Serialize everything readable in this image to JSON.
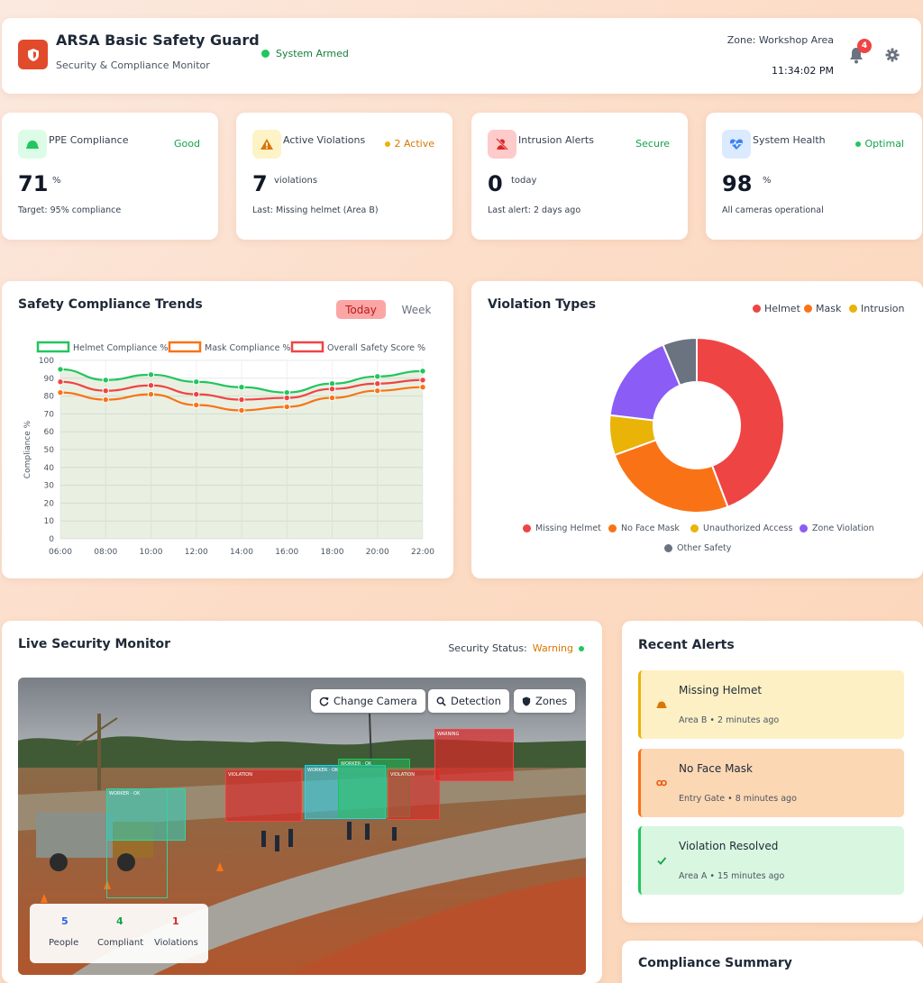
{
  "header": {
    "title": "ARSA Basic Safety Guard",
    "subtitle": "Security & Compliance Monitor",
    "system_status": "System Armed",
    "zone": "Zone: Workshop Area",
    "time": "11:34:02 PM",
    "notification_count": "4"
  },
  "stats": [
    {
      "label": "PPE Compliance",
      "badge": "Good",
      "value": "71",
      "unit": "%",
      "footer": "Target: 95% compliance",
      "badge_color": "#16a34a"
    },
    {
      "label": "Active Violations",
      "badge": "2 Active",
      "value": "7",
      "unit": "violations",
      "footer": "Last: Missing helmet (Area B)",
      "badge_color": "#d97706"
    },
    {
      "label": "Intrusion Alerts",
      "badge": "Secure",
      "value": "0",
      "unit": "today",
      "footer": "Last alert: 2 days ago",
      "badge_color": "#16a34a"
    },
    {
      "label": "System Health",
      "badge": "Optimal",
      "value": "98",
      "unit": "%",
      "footer": "All cameras operational",
      "badge_color": "#16a34a"
    }
  ],
  "trends": {
    "title": "Safety Compliance Trends",
    "tab_today": "Today",
    "tab_week": "Week"
  },
  "violations_panel": {
    "title": "Violation Types",
    "top_legend": [
      "Helmet",
      "Mask",
      "Intrusion"
    ]
  },
  "chart_data": [
    {
      "type": "line",
      "x": [
        "06:00",
        "08:00",
        "10:00",
        "12:00",
        "14:00",
        "16:00",
        "18:00",
        "20:00",
        "22:00"
      ],
      "ylabel": "Compliance %",
      "xlabel": "",
      "ylim": [
        0,
        100
      ],
      "yticks": [
        0,
        10,
        20,
        30,
        40,
        50,
        60,
        70,
        80,
        90,
        100
      ],
      "grid": true,
      "legend": "top",
      "series": [
        {
          "name": "Helmet Compliance %",
          "color": "#22c55e",
          "values": [
            95,
            89,
            92,
            88,
            85,
            82,
            87,
            91,
            94
          ]
        },
        {
          "name": "Mask Compliance %",
          "color": "#f97316",
          "values": [
            82,
            78,
            81,
            75,
            72,
            74,
            79,
            83,
            85
          ]
        },
        {
          "name": "Overall Safety Score %",
          "color": "#ef4444",
          "values": [
            88,
            83,
            86,
            81,
            78,
            79,
            84,
            87,
            89
          ]
        }
      ]
    },
    {
      "type": "pie",
      "title": "Violation Types",
      "categories": [
        "Missing Helmet",
        "No Face Mask",
        "Unauthorized Access",
        "Zone Violation",
        "Other Safety"
      ],
      "values": [
        42,
        24,
        7,
        16,
        6
      ],
      "colors": [
        "#ef4444",
        "#f97316",
        "#eab308",
        "#8b5cf6",
        "#6b7280"
      ],
      "legend": "bottom"
    }
  ],
  "monitor": {
    "title": "Live Security Monitor",
    "status_label": "Security Status:",
    "status_value": "Warning",
    "buttons": {
      "change_camera": "Change Camera",
      "detection": "Detection",
      "zones": "Zones"
    },
    "counts": [
      {
        "value": "5",
        "label": "People",
        "color": "#2563eb"
      },
      {
        "value": "4",
        "label": "Compliant",
        "color": "#16a34a"
      },
      {
        "value": "1",
        "label": "Violations",
        "color": "#dc2626"
      }
    ]
  },
  "alerts": {
    "title": "Recent Alerts",
    "items": [
      {
        "title": "Missing Helmet",
        "meta": "Area B • 2 minutes ago",
        "bg": "#fdf0c4",
        "border": "#eab308"
      },
      {
        "title": "No Face Mask",
        "meta": "Entry Gate • 8 minutes ago",
        "bg": "#fcd7b4",
        "border": "#f97316"
      },
      {
        "title": "Violation Resolved",
        "meta": "Area A • 15 minutes ago",
        "bg": "#d9f6e1",
        "border": "#22c55e"
      }
    ]
  },
  "summary": {
    "title": "Compliance Summary"
  }
}
